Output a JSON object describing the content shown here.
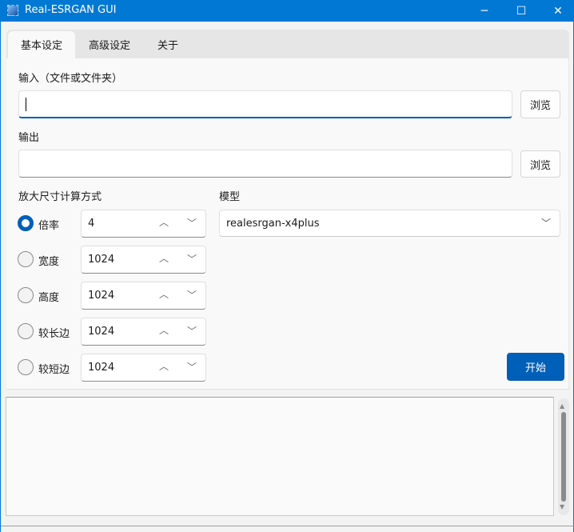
{
  "window": {
    "title": "Real-ESRGAN GUI",
    "minimize": "─",
    "maximize": "☐",
    "close": "✕"
  },
  "tabs": [
    {
      "label": "基本设定"
    },
    {
      "label": "高级设定"
    },
    {
      "label": "关于"
    }
  ],
  "input": {
    "label": "输入（文件或文件夹）",
    "value": "",
    "browse": "浏览"
  },
  "output": {
    "label": "输出",
    "value": "",
    "browse": "浏览"
  },
  "scale": {
    "label": "放大尺寸计算方式",
    "options": [
      {
        "label": "倍率",
        "value": "4",
        "selected": true
      },
      {
        "label": "宽度",
        "value": "1024",
        "selected": false
      },
      {
        "label": "高度",
        "value": "1024",
        "selected": false
      },
      {
        "label": "较长边",
        "value": "1024",
        "selected": false
      },
      {
        "label": "较短边",
        "value": "1024",
        "selected": false
      }
    ]
  },
  "model": {
    "label": "模型",
    "value": "realesrgan-x4plus"
  },
  "start": "开始",
  "log": ""
}
